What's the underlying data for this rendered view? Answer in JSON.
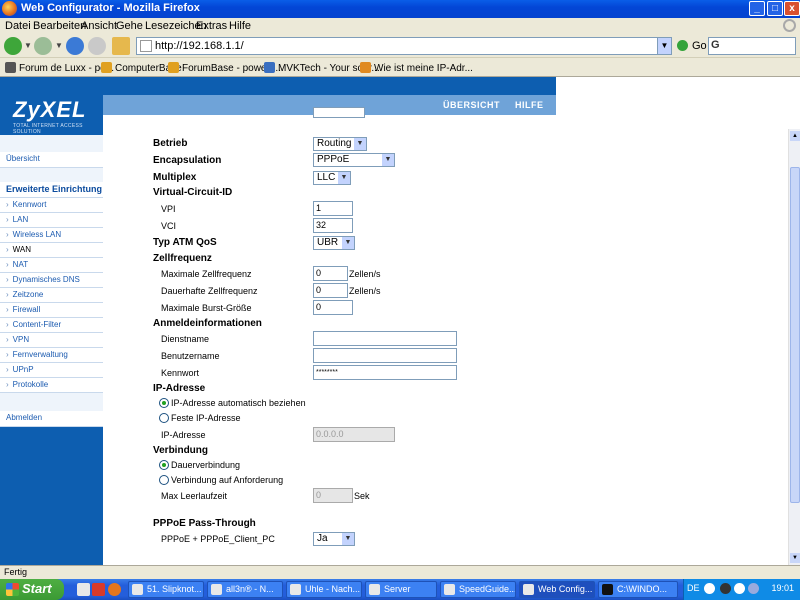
{
  "window": {
    "title": "Web Configurator - Mozilla Firefox",
    "min_glyph": "_",
    "max_glyph": "□",
    "close_glyph": "x"
  },
  "menubar": [
    "Datei",
    "Bearbeiten",
    "Ansicht",
    "Gehe",
    "Lesezeichen",
    "Extras",
    "Hilfe"
  ],
  "navbar": {
    "url": "http://192.168.1.1/",
    "go_label": "Go",
    "search_glyph": "G"
  },
  "bookmarks": [
    {
      "label": "Forum de Luxx - po...",
      "color": "#555555"
    },
    {
      "label": "ComputerBase",
      "color": "#e0a020"
    },
    {
      "label": "ForumBase - powere...",
      "color": "#e0a020"
    },
    {
      "label": "MVKTech - Your sour...",
      "color": "#3a6fc0"
    },
    {
      "label": "Wie ist meine IP-Adr...",
      "color": "#e08a20"
    }
  ],
  "zyxel": {
    "brand": "ZyXEL",
    "tagline": "TOTAL INTERNET ACCESS SOLUTION",
    "top_links": [
      "ÜBERSICHT",
      "HILFE"
    ],
    "menu": {
      "overview": "Übersicht",
      "advanced": "Erweiterte Einrichtung",
      "items": [
        "Kennwort",
        "LAN",
        "Wireless LAN",
        "WAN",
        "NAT",
        "Dynamisches DNS",
        "Zeitzone",
        "Firewall",
        "Content-Filter",
        "VPN",
        "Fernverwaltung",
        "UPnP",
        "Protokolle"
      ],
      "logout": "Abmelden"
    }
  },
  "form": {
    "betrieb": {
      "label": "Betrieb",
      "value": "Routing"
    },
    "encapsulation": {
      "label": "Encapsulation",
      "value": "PPPoE"
    },
    "multiplex": {
      "label": "Multiplex",
      "value": "LLC"
    },
    "vc_header": "Virtual-Circuit-ID",
    "vpi": {
      "label": "VPI",
      "value": "1"
    },
    "vci": {
      "label": "VCI",
      "value": "32"
    },
    "atm_qos": {
      "label": "Typ ATM QoS",
      "value": "UBR"
    },
    "zellfrequenz_header": "Zellfrequenz",
    "max_zell": {
      "label": "Maximale Zellfrequenz",
      "value": "0",
      "unit": "Zellen/s"
    },
    "dauer_zell": {
      "label": "Dauerhafte Zellfrequenz",
      "value": "0",
      "unit": "Zellen/s"
    },
    "max_burst": {
      "label": "Maximale Burst-Größe",
      "value": "0"
    },
    "anmelde_header": "Anmeldeinformationen",
    "dienstname": {
      "label": "Dienstname",
      "value": ""
    },
    "benutzername": {
      "label": "Benutzername",
      "value": ""
    },
    "kennwort": {
      "label": "Kennwort",
      "value": "********"
    },
    "ip_header": "IP-Adresse",
    "ip_auto": "IP-Adresse automatisch beziehen",
    "ip_fixed": "Feste IP-Adresse",
    "ip_addr": {
      "label": "IP-Adresse",
      "value": "0.0.0.0"
    },
    "verbindung_header": "Verbindung",
    "dauer": "Dauerverbindung",
    "anforderung": "Verbindung auf Anforderung",
    "leerlauf": {
      "label": "Max Leerlaufzeit",
      "value": "0",
      "unit": "Sek"
    },
    "passthrough_header": "PPPoE Pass-Through",
    "passthrough": {
      "label": "PPPoE + PPPoE_Client_PC",
      "value": "Ja"
    },
    "select_arrow": "▼"
  },
  "statusbar": "Fertig",
  "taskbar": {
    "start": "Start",
    "tasks": [
      "51. Slipknot...",
      "all3n® - N...",
      "Uhle - Nach...",
      "Server",
      "SpeedGuide...",
      "Web Config...",
      "C:\\WINDO..."
    ],
    "lang": "DE",
    "clock": "19:01"
  }
}
